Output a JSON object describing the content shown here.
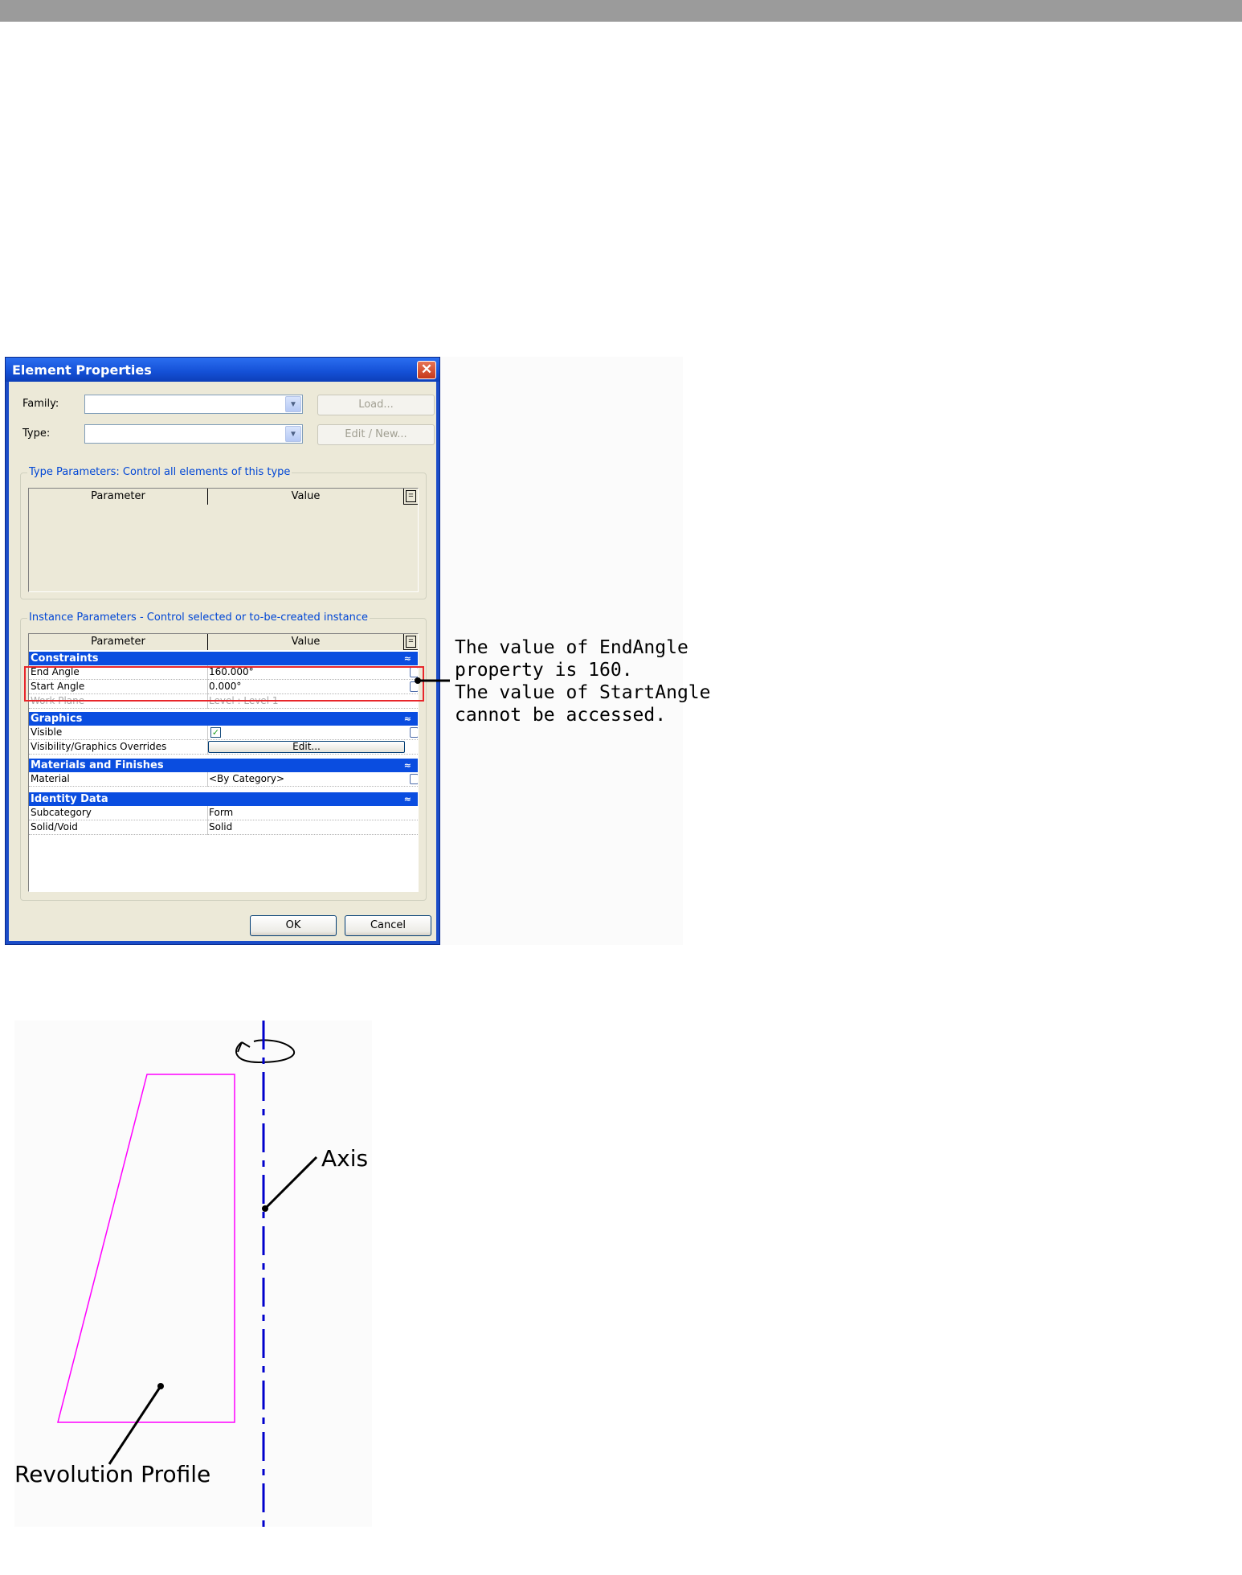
{
  "dialog": {
    "title": "Element Properties",
    "close_glyph": "✕",
    "family_label": "Family:",
    "family_value": "",
    "type_label": "Type:",
    "type_value": "",
    "load_button": "Load...",
    "edit_new_button": "Edit / New...",
    "type_params_title": "Type Parameters: Control all elements of this type",
    "instance_params_title": "Instance Parameters - Control selected or to-be-created instance",
    "col_parameter": "Parameter",
    "col_value": "Value",
    "col_toggle": "=",
    "collapse_glyph": "≈",
    "categories": {
      "constraints": "Constraints",
      "graphics": "Graphics",
      "materials": "Materials and Finishes",
      "identity": "Identity Data"
    },
    "rows": {
      "end_angle": {
        "name": "End Angle",
        "value": "160.000°"
      },
      "start_angle": {
        "name": "Start Angle",
        "value": "0.000°"
      },
      "work_plane": {
        "name": "Work Plane",
        "value": "Level : Level 1"
      },
      "visible": {
        "name": "Visible",
        "checked": true
      },
      "vis_overrides": {
        "name": "Visibility/Graphics Overrides",
        "button": "Edit..."
      },
      "material": {
        "name": "Material",
        "value": "<By Category>"
      },
      "subcategory": {
        "name": "Subcategory",
        "value": "Form"
      },
      "solid_void": {
        "name": "Solid/Void",
        "value": "Solid"
      }
    },
    "ok_button": "OK",
    "cancel_button": "Cancel"
  },
  "annotation": {
    "line1": "The value of EndAngle",
    "line2": "property is 160.",
    "line3": "The value of StartAngle",
    "line4": "cannot be accessed."
  },
  "drawing": {
    "axis_label": "Axis",
    "profile_label": "Revolution Profile",
    "profile_color": "#ff00ff",
    "axis_color": "#0000cc"
  },
  "colors": {
    "highlight_box": "#e8262b",
    "category_header": "#0a4de0",
    "titlebar": "#1450d6"
  }
}
